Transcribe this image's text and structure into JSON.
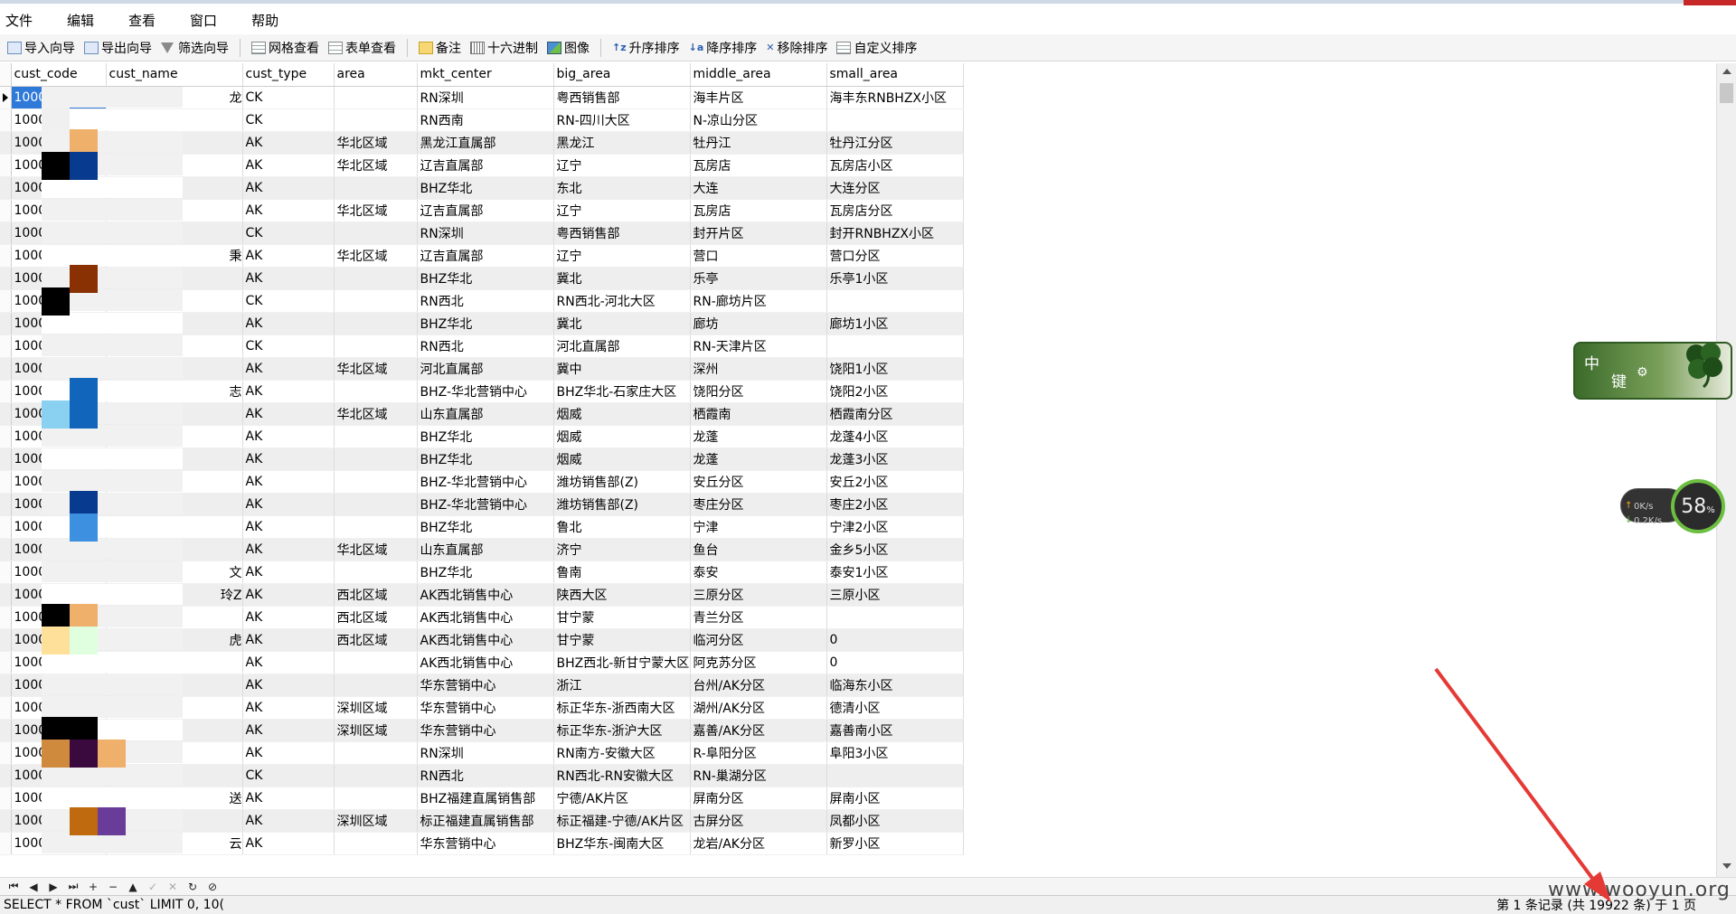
{
  "menu": [
    "文件",
    "编辑",
    "查看",
    "窗口",
    "帮助"
  ],
  "toolbar": {
    "import": "导入向导",
    "export": "导出向导",
    "filter": "筛选向导",
    "grid_view": "网格查看",
    "form_view": "表单查看",
    "note": "备注",
    "hex": "十六进制",
    "image": "图像",
    "asc": "升序排序",
    "desc": "降序排序",
    "remove_sort": "移除排序",
    "custom_sort": "自定义排序"
  },
  "columns": [
    "cust_code",
    "cust_name",
    "cust_type",
    "area",
    "mkt_center",
    "big_area",
    "middle_area",
    "small_area"
  ],
  "rows": [
    {
      "code": "1000",
      "name": "龙",
      "type": "CK",
      "area": "",
      "mkt": "RN深圳",
      "big": "粤西销售部",
      "mid": "海丰片区",
      "small": "海丰东RNBHZX小区"
    },
    {
      "code": "1000",
      "name": "",
      "type": "CK",
      "area": "",
      "mkt": "RN西南",
      "big": "RN-四川大区",
      "mid": "N-凉山分区",
      "small": ""
    },
    {
      "code": "1000",
      "name": "",
      "type": "AK",
      "area": "华北区域",
      "mkt": "黑龙江直属部",
      "big": "黑龙江",
      "mid": "牡丹江",
      "small": "牡丹江分区"
    },
    {
      "code": "1000",
      "name": "",
      "type": "AK",
      "area": "华北区域",
      "mkt": "辽吉直属部",
      "big": "辽宁",
      "mid": "瓦房店",
      "small": "瓦房店小区"
    },
    {
      "code": "1000",
      "name": "",
      "type": "AK",
      "area": "",
      "mkt": "BHZ华北",
      "big": "东北",
      "mid": "大连",
      "small": "大连分区"
    },
    {
      "code": "1000",
      "name": "",
      "type": "AK",
      "area": "华北区域",
      "mkt": "辽吉直属部",
      "big": "辽宁",
      "mid": "瓦房店",
      "small": "瓦房店分区"
    },
    {
      "code": "1000",
      "name": "",
      "type": "CK",
      "area": "",
      "mkt": "RN深圳",
      "big": "粤西销售部",
      "mid": "封开片区",
      "small": "封开RNBHZX小区"
    },
    {
      "code": "1000",
      "name": "秉",
      "type": "AK",
      "area": "华北区域",
      "mkt": "辽吉直属部",
      "big": "辽宁",
      "mid": "营口",
      "small": "营口分区"
    },
    {
      "code": "1000",
      "name": "",
      "type": "AK",
      "area": "",
      "mkt": "BHZ华北",
      "big": "冀北",
      "mid": "乐亭",
      "small": "乐亭1小区"
    },
    {
      "code": "1000",
      "name": "",
      "type": "CK",
      "area": "",
      "mkt": "RN西北",
      "big": "RN西北-河北大区",
      "mid": "RN-廊坊片区",
      "small": ""
    },
    {
      "code": "1000",
      "name": "",
      "type": "AK",
      "area": "",
      "mkt": "BHZ华北",
      "big": "冀北",
      "mid": "廊坊",
      "small": "廊坊1小区"
    },
    {
      "code": "1000",
      "name": "",
      "type": "CK",
      "area": "",
      "mkt": "RN西北",
      "big": "河北直属部",
      "mid": "RN-天津片区",
      "small": ""
    },
    {
      "code": "1000",
      "name": "",
      "type": "AK",
      "area": "华北区域",
      "mkt": "河北直属部",
      "big": "冀中",
      "mid": "深州",
      "small": "饶阳1小区"
    },
    {
      "code": "1000",
      "name": "志",
      "type": "AK",
      "area": "",
      "mkt": "BHZ-华北营销中心",
      "big": "BHZ华北-石家庄大区",
      "mid": "饶阳分区",
      "small": "饶阳2小区"
    },
    {
      "code": "1000",
      "name": "",
      "type": "AK",
      "area": "华北区域",
      "mkt": "山东直属部",
      "big": "烟威",
      "mid": "栖霞南",
      "small": "栖霞南分区"
    },
    {
      "code": "1000",
      "name": "",
      "type": "AK",
      "area": "",
      "mkt": "BHZ华北",
      "big": "烟威",
      "mid": "龙蓬",
      "small": "龙蓬4小区"
    },
    {
      "code": "1000",
      "name": "",
      "type": "AK",
      "area": "",
      "mkt": "BHZ华北",
      "big": "烟威",
      "mid": "龙蓬",
      "small": "龙蓬3小区"
    },
    {
      "code": "1000",
      "name": "",
      "type": "AK",
      "area": "",
      "mkt": "BHZ-华北营销中心",
      "big": "潍坊销售部(Z)",
      "mid": "安丘分区",
      "small": "安丘2小区"
    },
    {
      "code": "1000",
      "name": "",
      "type": "AK",
      "area": "",
      "mkt": "BHZ-华北营销中心",
      "big": "潍坊销售部(Z)",
      "mid": "枣庄分区",
      "small": "枣庄2小区"
    },
    {
      "code": "1000",
      "name": "",
      "type": "AK",
      "area": "",
      "mkt": "BHZ华北",
      "big": "鲁北",
      "mid": "宁津",
      "small": "宁津2小区"
    },
    {
      "code": "1000",
      "name": "",
      "type": "AK",
      "area": "华北区域",
      "mkt": "山东直属部",
      "big": "济宁",
      "mid": "鱼台",
      "small": "金乡5小区"
    },
    {
      "code": "1000",
      "name": "文",
      "type": "AK",
      "area": "",
      "mkt": "BHZ华北",
      "big": "鲁南",
      "mid": "泰安",
      "small": "泰安1小区"
    },
    {
      "code": "1000",
      "name": "玲Z",
      "type": "AK",
      "area": "西北区域",
      "mkt": "AK西北销售中心",
      "big": "陕西大区",
      "mid": "三原分区",
      "small": "三原小区"
    },
    {
      "code": "1000",
      "name": "",
      "type": "AK",
      "area": "西北区域",
      "mkt": "AK西北销售中心",
      "big": "甘宁蒙",
      "mid": "青兰分区",
      "small": ""
    },
    {
      "code": "1000",
      "name": "虎",
      "type": "AK",
      "area": "西北区域",
      "mkt": "AK西北销售中心",
      "big": "甘宁蒙",
      "mid": "临河分区",
      "small": "0"
    },
    {
      "code": "1000",
      "name": "",
      "type": "AK",
      "area": "",
      "mkt": "AK西北销售中心",
      "big": "BHZ西北-新甘宁蒙大区",
      "mid": "阿克苏分区",
      "small": "0"
    },
    {
      "code": "1000",
      "name": "",
      "type": "AK",
      "area": "",
      "mkt": "华东营销中心",
      "big": "浙江",
      "mid": "台州/AK分区",
      "small": "临海东小区"
    },
    {
      "code": "1000",
      "name": "",
      "type": "AK",
      "area": "深圳区域",
      "mkt": "华东营销中心",
      "big": "标正华东-浙西南大区",
      "mid": "湖州/AK分区",
      "small": "德清小区"
    },
    {
      "code": "1000",
      "name": "",
      "type": "AK",
      "area": "深圳区域",
      "mkt": "华东营销中心",
      "big": "标正华东-浙沪大区",
      "mid": "嘉善/AK分区",
      "small": "嘉善南小区"
    },
    {
      "code": "1000",
      "name": "",
      "type": "AK",
      "area": "",
      "mkt": "RN深圳",
      "big": "RN南方-安徽大区",
      "mid": "R-阜阳分区",
      "small": "阜阳3小区"
    },
    {
      "code": "1000",
      "name": "",
      "type": "CK",
      "area": "",
      "mkt": "RN西北",
      "big": "RN西北-RN安徽大区",
      "mid": "RN-巢湖分区",
      "small": ""
    },
    {
      "code": "1000",
      "name": "送",
      "type": "AK",
      "area": "",
      "mkt": "BHZ福建直属销售部",
      "big": "宁德/AK片区",
      "mid": "屏南分区",
      "small": "屏南小区"
    },
    {
      "code": "1000",
      "name": "",
      "type": "AK",
      "area": "深圳区域",
      "mkt": "标正福建直属销售部",
      "big": "标正福建-宁德/AK片区",
      "mid": "古屏分区",
      "small": "凤都小区"
    },
    {
      "code": "1000",
      "name": "云",
      "type": "AK",
      "area": "",
      "mkt": "华东营销中心",
      "big": "BHZ华东-闽南大区",
      "mid": "龙岩/AK分区",
      "small": "新罗小区"
    }
  ],
  "status": {
    "sql": "SELECT * FROM `cust` LIMIT 0, 10(",
    "records": "第 1 条记录 (共 19922 条) 于 1 页"
  },
  "ime": {
    "zh": "中",
    "key": "键"
  },
  "netmon": {
    "up": "0K/s",
    "down": "0.2K/s",
    "percent": "58",
    "unit": "%"
  },
  "watermark": "www.wooyun.org"
}
